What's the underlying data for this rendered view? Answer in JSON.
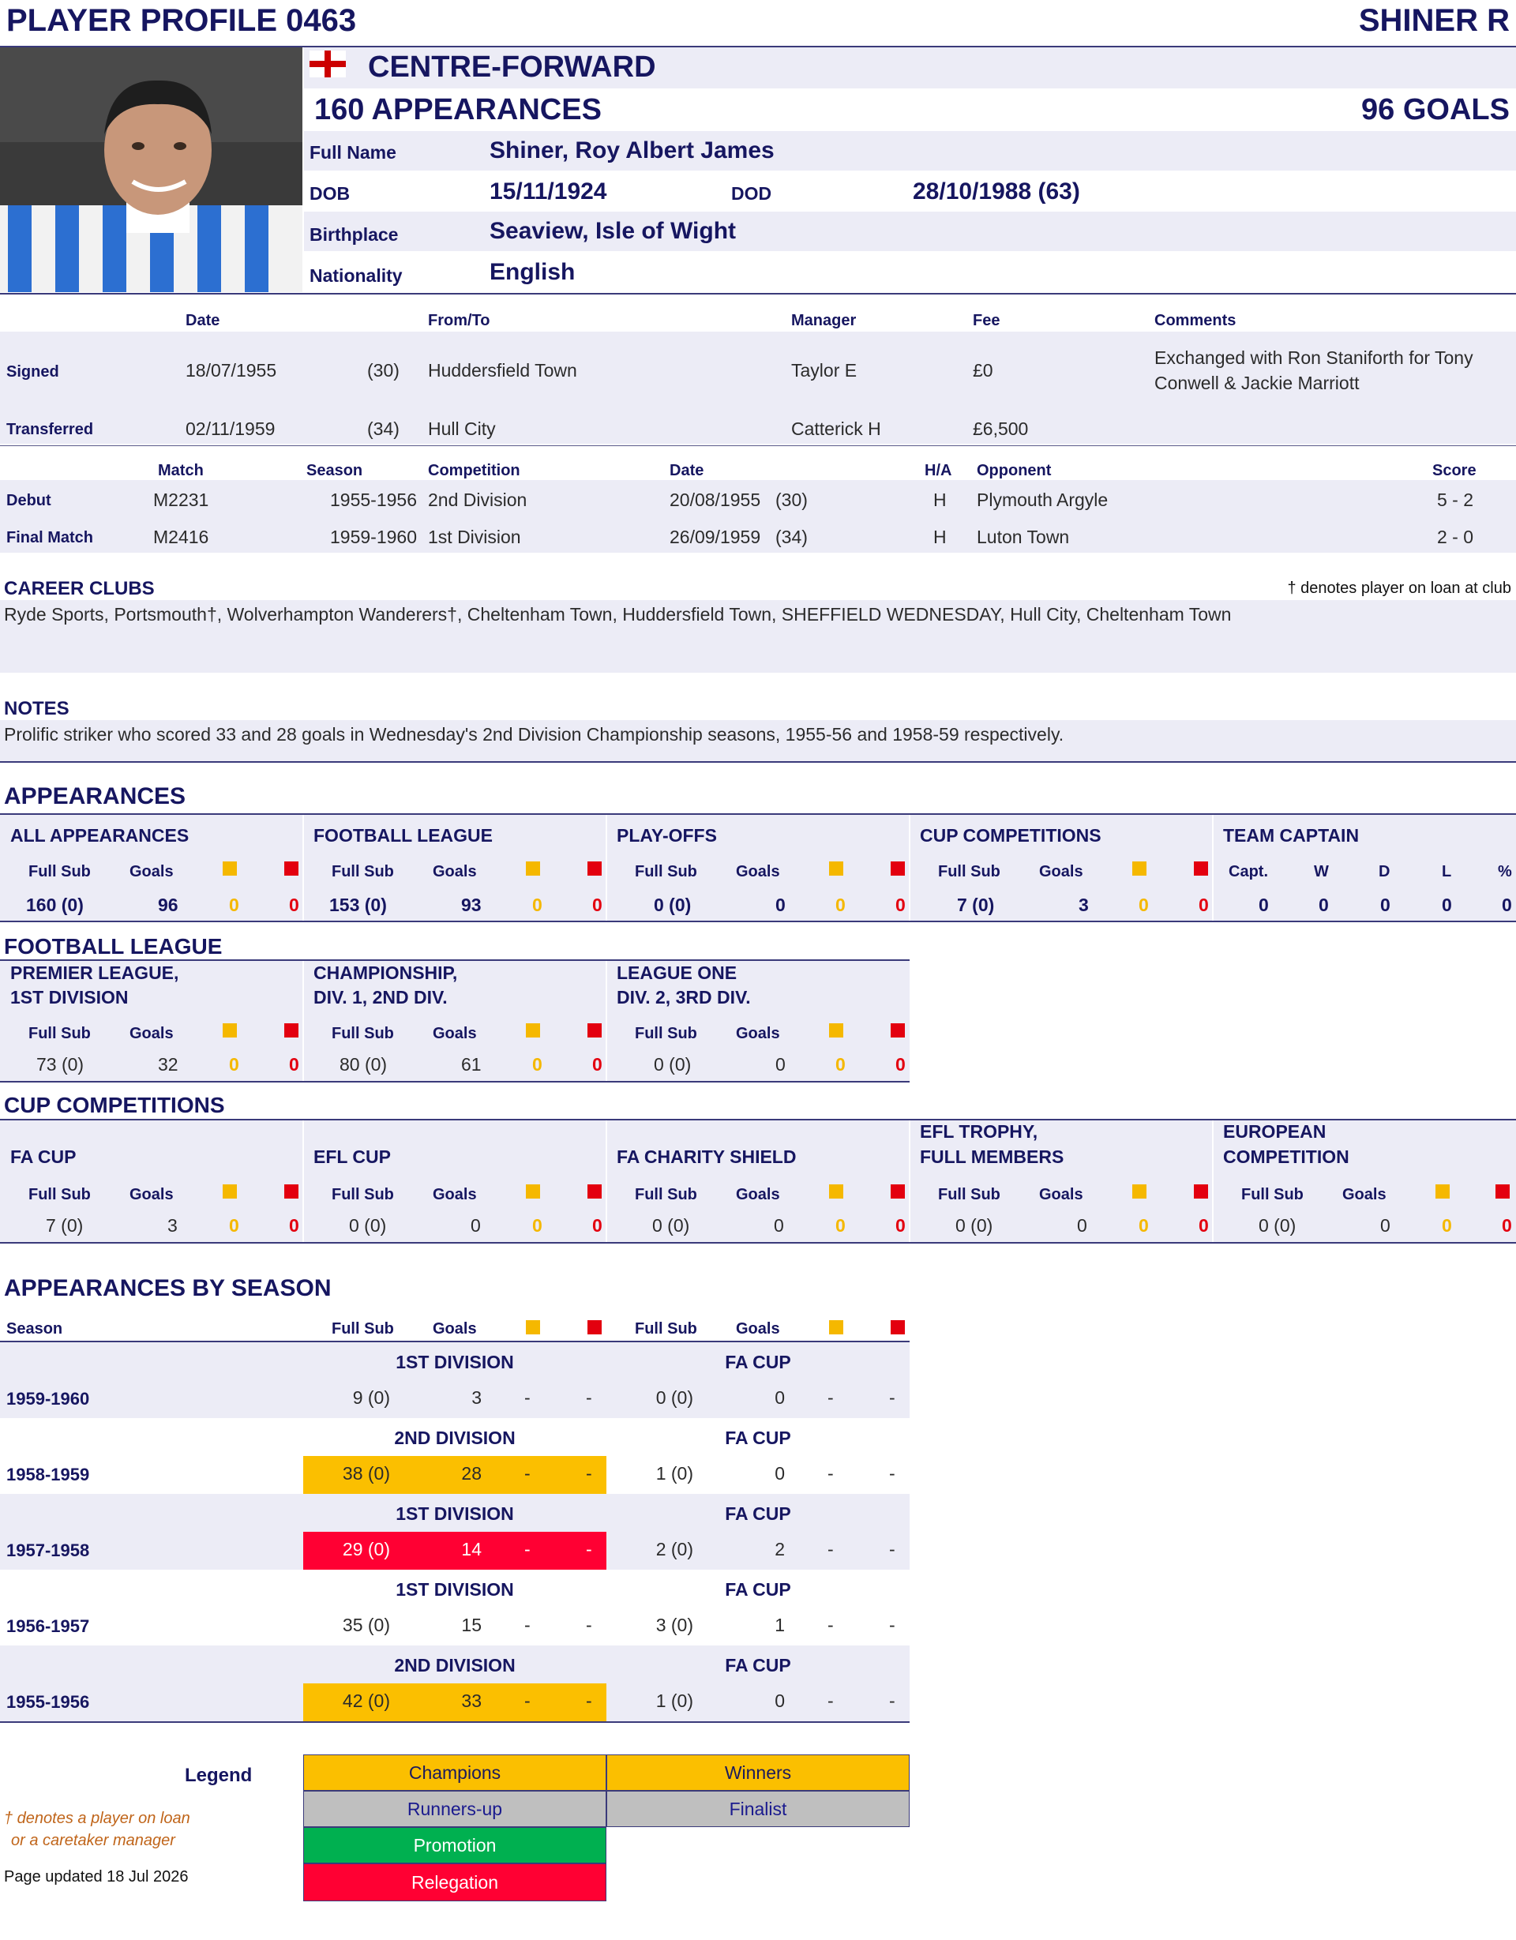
{
  "header": {
    "profile_title": "PLAYER PROFILE 0463",
    "player_short": "SHINER R"
  },
  "bio": {
    "position": "CENTRE-FORWARD",
    "appearances": "160 APPEARANCES",
    "goals": "96 GOALS",
    "full_name_label": "Full Name",
    "full_name": "Shiner, Roy Albert James",
    "dob_label": "DOB",
    "dob": "15/11/1924",
    "dod_label": "DOD",
    "dod": "28/10/1988  (63)",
    "birthplace_label": "Birthplace",
    "birthplace": "Seaview, Isle of Wight",
    "nationality_label": "Nationality",
    "nationality": "English"
  },
  "transfers": {
    "headers": [
      "Date",
      "From/To",
      "Manager",
      "Fee",
      "Comments"
    ],
    "rows": [
      {
        "label": "Signed",
        "date": "18/07/1955",
        "age": "(30)",
        "club": "Huddersfield Town",
        "manager": "Taylor E",
        "fee": "£0",
        "comments1": "Exchanged with Ron Staniforth for Tony",
        "comments2": "Conwell & Jackie Marriott"
      },
      {
        "label": "Transferred",
        "date": "02/11/1959",
        "age": "(34)",
        "club": "Hull City",
        "manager": "Catterick H",
        "fee": "£6,500",
        "comments1": "",
        "comments2": ""
      }
    ]
  },
  "matches": {
    "headers": [
      "Match",
      "Season",
      "Competition",
      "Date",
      "H/A",
      "Opponent",
      "Score"
    ],
    "rows": [
      {
        "label": "Debut",
        "match": "M2231",
        "season": "1955-1956",
        "competition": "2nd Division",
        "date": "20/08/1955",
        "age": "(30)",
        "ha": "H",
        "opponent": "Plymouth Argyle",
        "score": "5 - 2"
      },
      {
        "label": "Final Match",
        "match": "M2416",
        "season": "1959-1960",
        "competition": "1st Division",
        "date": "26/09/1959",
        "age": "(34)",
        "ha": "H",
        "opponent": "Luton Town",
        "score": "2 - 0"
      }
    ]
  },
  "career": {
    "title": "CAREER CLUBS",
    "loan_note": "† denotes player on loan at club",
    "clubs": "Ryde Sports, Portsmouth†, Wolverhampton Wanderers†, Cheltenham Town, Huddersfield Town, SHEFFIELD WEDNESDAY, Hull City, Cheltenham Town"
  },
  "notes": {
    "title": "NOTES",
    "text": "Prolific striker who scored 33 and 28 goals in Wednesday's 2nd Division Championship seasons, 1955-56 and 1958-59 respectively."
  },
  "appearances": {
    "title": "APPEARANCES",
    "col_full_sub": "Full Sub",
    "col_goals": "Goals",
    "groups": [
      {
        "title": "ALL APPEARANCES",
        "apps": "160 (0)",
        "goals": "96",
        "y": "0",
        "r": "0"
      },
      {
        "title": "FOOTBALL LEAGUE",
        "apps": "153 (0)",
        "goals": "93",
        "y": "0",
        "r": "0"
      },
      {
        "title": "PLAY-OFFS",
        "apps": "0 (0)",
        "goals": "0",
        "y": "0",
        "r": "0"
      },
      {
        "title": "CUP COMPETITIONS",
        "apps": "7 (0)",
        "goals": "3",
        "y": "0",
        "r": "0"
      }
    ],
    "captain": {
      "title": "TEAM CAPTAIN",
      "headers": [
        "Capt.",
        "W",
        "D",
        "L",
        "%"
      ],
      "values": [
        "0",
        "0",
        "0",
        "0",
        "0"
      ]
    }
  },
  "league": {
    "title": "FOOTBALL LEAGUE",
    "groups": [
      {
        "t1": "PREMIER LEAGUE,",
        "t2": "1ST DIVISION",
        "apps": "73 (0)",
        "goals": "32",
        "y": "0",
        "r": "0"
      },
      {
        "t1": "CHAMPIONSHIP,",
        "t2": "DIV. 1, 2ND DIV.",
        "apps": "80 (0)",
        "goals": "61",
        "y": "0",
        "r": "0"
      },
      {
        "t1": "LEAGUE ONE",
        "t2": "DIV. 2, 3RD DIV.",
        "apps": "0 (0)",
        "goals": "0",
        "y": "0",
        "r": "0"
      }
    ]
  },
  "cups": {
    "title": "CUP COMPETITIONS",
    "groups": [
      {
        "t1": "",
        "t2": "FA CUP",
        "apps": "7 (0)",
        "goals": "3",
        "y": "0",
        "r": "0"
      },
      {
        "t1": "",
        "t2": "EFL CUP",
        "apps": "0 (0)",
        "goals": "0",
        "y": "0",
        "r": "0"
      },
      {
        "t1": "",
        "t2": "FA CHARITY SHIELD",
        "apps": "0 (0)",
        "goals": "0",
        "y": "0",
        "r": "0"
      },
      {
        "t1": "EFL TROPHY,",
        "t2": "FULL MEMBERS",
        "apps": "0 (0)",
        "goals": "0",
        "y": "0",
        "r": "0"
      },
      {
        "t1": "EUROPEAN",
        "t2": "COMPETITION",
        "apps": "0 (0)",
        "goals": "0",
        "y": "0",
        "r": "0"
      }
    ]
  },
  "by_season": {
    "title": "APPEARANCES BY SEASON",
    "season_label": "Season",
    "rows": [
      {
        "season": "1959-1960",
        "league": "1ST DIVISION",
        "l_apps": "9 (0)",
        "l_goals": "3",
        "l_y": "-",
        "l_r": "-",
        "cup": "FA CUP",
        "c_apps": "0 (0)",
        "c_goals": "0",
        "c_y": "-",
        "c_r": "-",
        "status": "none"
      },
      {
        "season": "1958-1959",
        "league": "2ND DIVISION",
        "l_apps": "38 (0)",
        "l_goals": "28",
        "l_y": "-",
        "l_r": "-",
        "cup": "FA CUP",
        "c_apps": "1 (0)",
        "c_goals": "0",
        "c_y": "-",
        "c_r": "-",
        "status": "champions"
      },
      {
        "season": "1957-1958",
        "league": "1ST DIVISION",
        "l_apps": "29 (0)",
        "l_goals": "14",
        "l_y": "-",
        "l_r": "-",
        "cup": "FA CUP",
        "c_apps": "2 (0)",
        "c_goals": "2",
        "c_y": "-",
        "c_r": "-",
        "status": "relegation"
      },
      {
        "season": "1956-1957",
        "league": "1ST DIVISION",
        "l_apps": "35 (0)",
        "l_goals": "15",
        "l_y": "-",
        "l_r": "-",
        "cup": "FA CUP",
        "c_apps": "3 (0)",
        "c_goals": "1",
        "c_y": "-",
        "c_r": "-",
        "status": "none"
      },
      {
        "season": "1955-1956",
        "league": "2ND DIVISION",
        "l_apps": "42 (0)",
        "l_goals": "33",
        "l_y": "-",
        "l_r": "-",
        "cup": "FA CUP",
        "c_apps": "1 (0)",
        "c_goals": "0",
        "c_y": "-",
        "c_r": "-",
        "status": "champions"
      }
    ]
  },
  "legend": {
    "title": "Legend",
    "champions": "Champions",
    "winners": "Winners",
    "runners_up": "Runners-up",
    "finalist": "Finalist",
    "promotion": "Promotion",
    "relegation": "Relegation",
    "loan_note1": "† denotes a player on loan",
    "loan_note2": "or a caretaker manager",
    "updated": "Page updated 18 Jul 2026"
  },
  "colors": {
    "champions": "#fbbf00",
    "runners_up": "#bfbfbf",
    "promotion": "#00b050",
    "relegation": "#ff0033",
    "navy": "#161660",
    "band": "#ececf6"
  }
}
